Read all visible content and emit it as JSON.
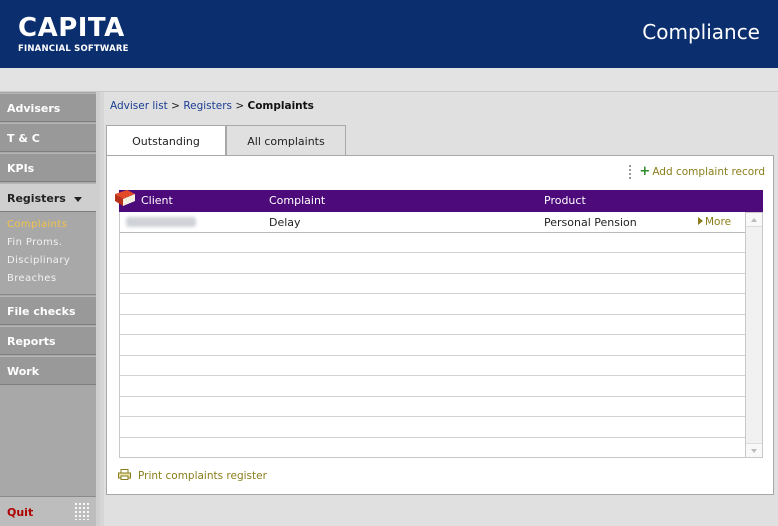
{
  "header": {
    "logo_main": "CAPITA",
    "logo_sub": "FINANCIAL SOFTWARE",
    "app_title": "Compliance",
    "brand_color": "#0b2e6f"
  },
  "sidebar": {
    "items": [
      {
        "label": "Advisers"
      },
      {
        "label": "T & C"
      },
      {
        "label": "KPIs"
      },
      {
        "label": "Registers"
      },
      {
        "label": "File checks"
      },
      {
        "label": "Reports"
      },
      {
        "label": "Work"
      }
    ],
    "registers_sub": [
      {
        "label": "Complaints"
      },
      {
        "label": "Fin Proms."
      },
      {
        "label": "Disciplinary"
      },
      {
        "label": "Breaches"
      }
    ],
    "quit_label": "Quit"
  },
  "breadcrumb": {
    "adviser_list": "Adviser list",
    "registers": "Registers",
    "current": "Complaints",
    "separator": ">"
  },
  "tabs": {
    "outstanding": "Outstanding",
    "all": "All complaints"
  },
  "actions": {
    "add_record": "Add complaint record",
    "print_register": "Print complaints register"
  },
  "table": {
    "headers": {
      "client": "Client",
      "complaint": "Complaint",
      "product": "Product"
    },
    "header_color": "#4d0a7a",
    "rows": [
      {
        "client": "",
        "complaint": "Delay",
        "product": "Personal Pension",
        "more": "More"
      }
    ]
  },
  "icons": {
    "book": "book-icon",
    "plus": "plus-icon",
    "printer": "printer-icon",
    "more_arrow": "play-arrow-icon"
  }
}
